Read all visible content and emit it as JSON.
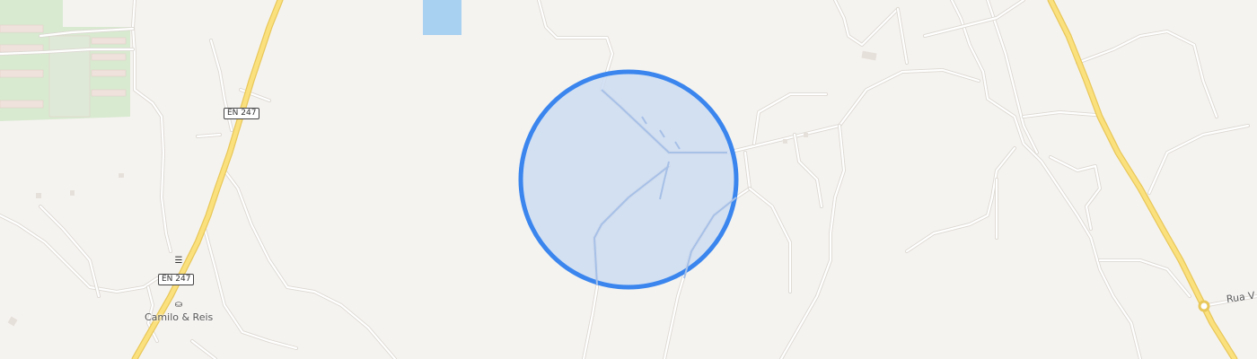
{
  "map": {
    "colors": {
      "background": "#f5f3f0",
      "park": "#d8ead0",
      "water": "#a8d0f0",
      "main_road": "#fbe07e",
      "minor_road": "#ffffff",
      "radius_fill": "#cddcf2",
      "radius_stroke": "#3a86ee"
    },
    "shields": [
      {
        "name": "en247-top",
        "text": "EN 247"
      },
      {
        "name": "en247-bottom",
        "text": "EN 247"
      }
    ],
    "pois": [
      {
        "name": "camilo-reis",
        "label": "Camilo & Reis",
        "icon": "shopping-basket-icon"
      },
      {
        "name": "restaurant",
        "label": "",
        "icon": "restaurant-icon"
      }
    ],
    "road_labels": [
      {
        "name": "rua-label",
        "text": "Rua V"
      }
    ],
    "overlay": {
      "type": "radius-circle",
      "icon": "search-radius"
    }
  }
}
